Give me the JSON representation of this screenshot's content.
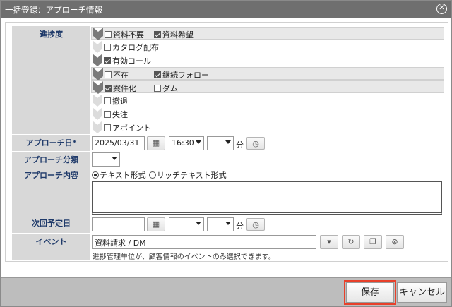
{
  "dialog": {
    "title": "一括登録：アプローチ情報",
    "close_icon": "close-circle-icon"
  },
  "fields": {
    "progress": {
      "label": "進捗度",
      "stages": [
        {
          "options": [
            {
              "text": "資料不要",
              "checked": false
            },
            {
              "text": "資料希望",
              "checked": true
            }
          ],
          "highlight": true,
          "active": true
        },
        {
          "options": [
            {
              "text": "カタログ配布",
              "checked": false
            }
          ],
          "highlight": false,
          "active": false
        },
        {
          "options": [
            {
              "text": "有効コール",
              "checked": true
            }
          ],
          "highlight": false,
          "active": true
        },
        {
          "options": [
            {
              "text": "不在",
              "checked": false
            },
            {
              "text": "継続フォロー",
              "checked": true
            }
          ],
          "highlight": true,
          "active": true
        },
        {
          "options": [
            {
              "text": "案件化",
              "checked": true
            },
            {
              "text": "ダム",
              "checked": false
            }
          ],
          "highlight": true,
          "active": true
        },
        {
          "options": [
            {
              "text": "撤退",
              "checked": false
            }
          ],
          "highlight": false,
          "active": false
        },
        {
          "options": [
            {
              "text": "失注",
              "checked": false
            }
          ],
          "highlight": false,
          "active": false
        },
        {
          "options": [
            {
              "text": "アポイント",
              "checked": false
            }
          ],
          "highlight": false,
          "active": false
        }
      ]
    },
    "approach_date": {
      "label": "アプローチ日*",
      "date": "2025/03/31",
      "hour": "16:30",
      "minute": "",
      "minute_unit": "分"
    },
    "approach_category": {
      "label": "アプローチ分類",
      "value": ""
    },
    "approach_content": {
      "label": "アプローチ内容",
      "format_text": "テキスト形式",
      "format_rich": "リッチテキスト形式",
      "selected": "text",
      "value": ""
    },
    "next_date": {
      "label": "次回予定日",
      "date": "",
      "hour": "",
      "minute": "",
      "minute_unit": "分"
    },
    "event": {
      "label": "イベント",
      "value": "資料請求 / DM",
      "hint": "進捗管理単位が、顧客情報のイベントのみ選択できます。"
    }
  },
  "footer": {
    "save_label": "保存",
    "cancel_label": "キャンセル"
  },
  "colors": {
    "titlebar": "#6f6f6f",
    "label_bg": "#d8d8d8",
    "label_text": "#1f3a6a",
    "highlight_outline": "#e8402a"
  }
}
